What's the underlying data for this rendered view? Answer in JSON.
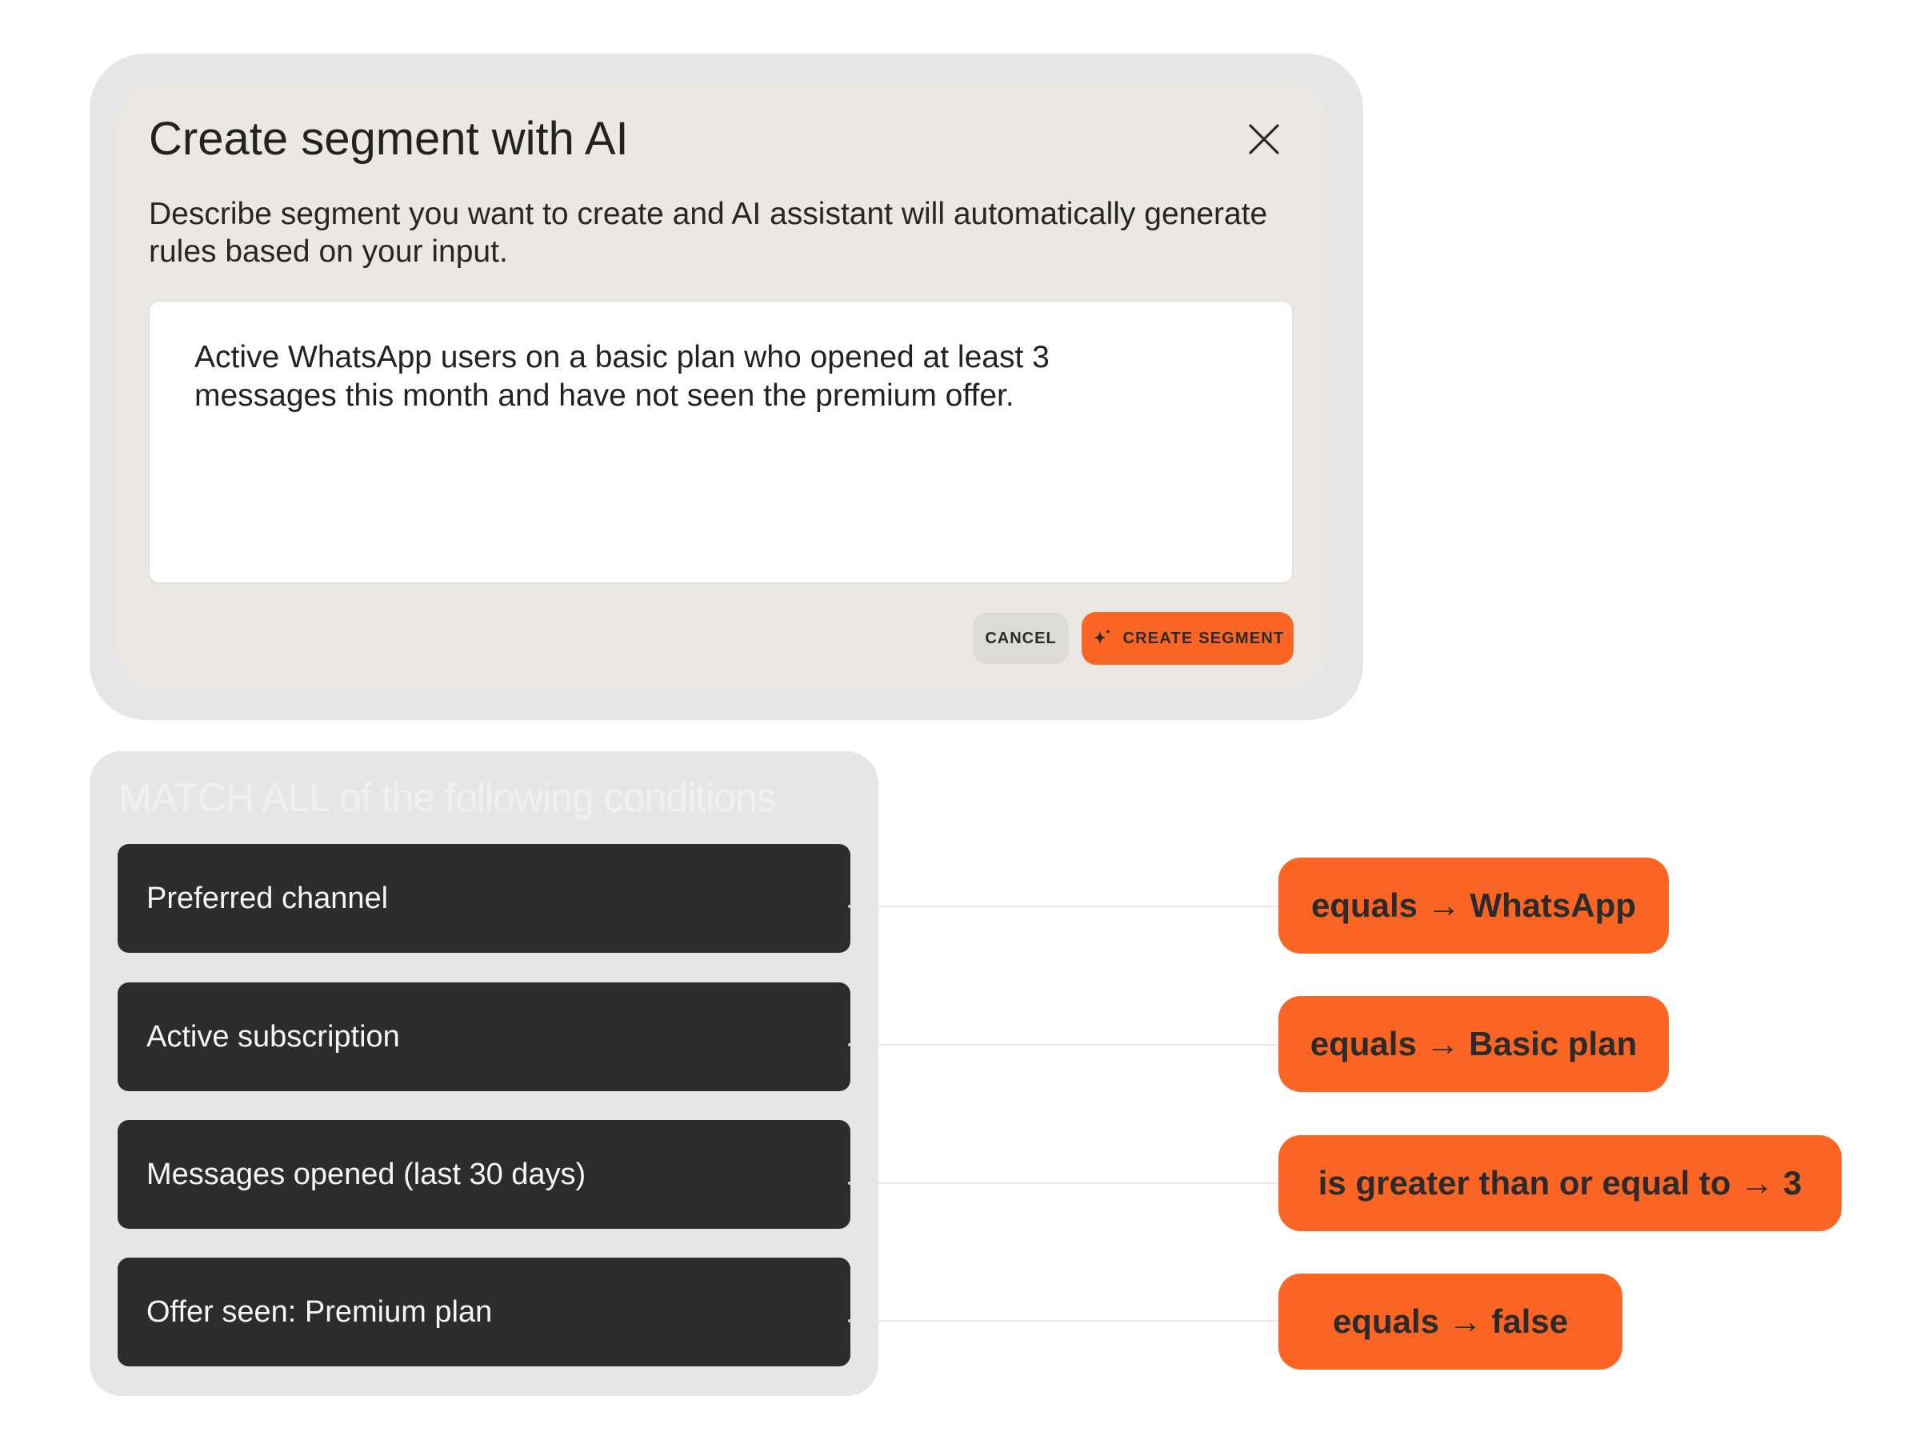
{
  "modal": {
    "title": "Create segment with AI",
    "description": "Describe segment you want to create and AI assistant will automatically generate rules based on your input.",
    "prompt_text": "Active WhatsApp users on a basic plan who opened at least 3 messages this month and have not seen the premium offer.",
    "cancel_label": "CANCEL",
    "create_label": "CREATE SEGMENT",
    "accent_color": "#fa6523"
  },
  "conditions": {
    "heading": "MATCH ALL of the following conditions",
    "items": [
      {
        "field": "Preferred channel",
        "rule": "equals → WhatsApp"
      },
      {
        "field": "Active subscription",
        "rule": "equals → Basic plan"
      },
      {
        "field": "Messages opened (last 30 days)",
        "rule": "is greater than or equal to → 3"
      },
      {
        "field": "Offer seen: Premium plan",
        "rule": "equals → false"
      }
    ]
  }
}
